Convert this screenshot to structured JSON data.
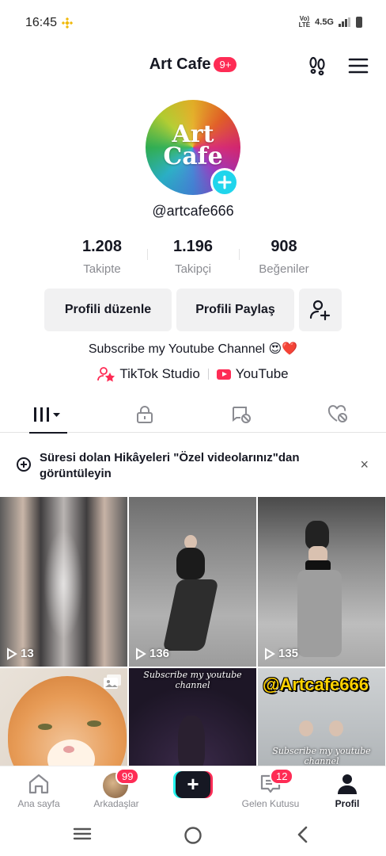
{
  "status_bar": {
    "time": "16:45",
    "net_label_top": "Vo)",
    "net_label_bottom": "LTE",
    "network": "4.5G"
  },
  "header": {
    "title": "Art Cafe",
    "notification_badge": "9+"
  },
  "profile": {
    "avatar_text_line1": "Art",
    "avatar_text_line2": "Cafe",
    "username": "@artcafe666",
    "stats": [
      {
        "value": "1.208",
        "label": "Takipte"
      },
      {
        "value": "1.196",
        "label": "Takipçi"
      },
      {
        "value": "908",
        "label": "Beğeniler"
      }
    ],
    "edit_button": "Profili düzenle",
    "share_button": "Profili Paylaş",
    "bio": "Subscribe my Youtube Channel 😍❤️",
    "links": {
      "studio": "TikTok Studio",
      "youtube": "YouTube"
    }
  },
  "tabs": [
    "videos-grid",
    "private-lock",
    "reposts",
    "liked"
  ],
  "banner": {
    "text": "Süresi dolan Hikâyeleri \"Özel videolarınız\"dan görüntüleyin",
    "close": "×"
  },
  "grid": {
    "videos": [
      {
        "views": "13"
      },
      {
        "views": "136"
      },
      {
        "views": "135"
      },
      {
        "views": ""
      },
      {
        "views": "",
        "caption": "Subscribe my youtube channel"
      },
      {
        "views": "",
        "watermark": "@Artcafe666",
        "caption": "Subscribe my youtube channel"
      }
    ]
  },
  "bottom_nav": {
    "home": "Ana sayfa",
    "friends": "Arkadaşlar",
    "friends_badge": "99",
    "create": "+",
    "inbox": "Gelen Kutusu",
    "inbox_badge": "12",
    "profile": "Profil"
  },
  "colors": {
    "accent": "#fe2c55",
    "cyan": "#25f4ee",
    "text": "#161823",
    "muted": "#8a8b91"
  }
}
